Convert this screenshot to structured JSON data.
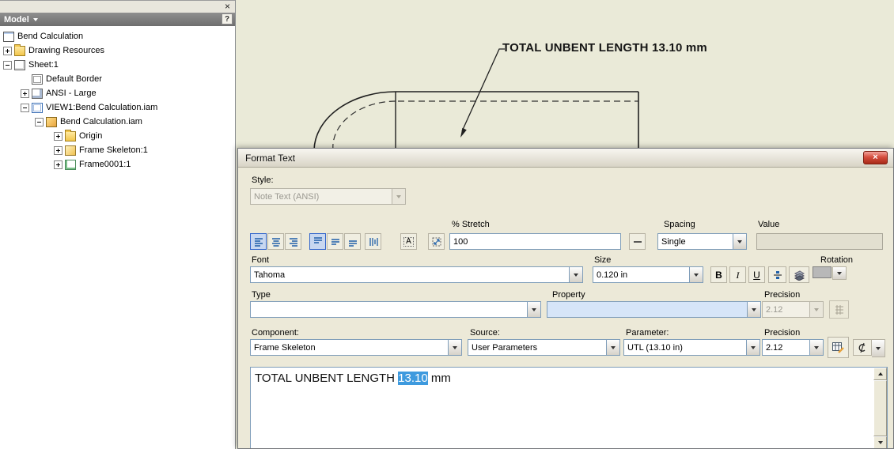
{
  "colors": {
    "selection_highlight": "#3E9ADE",
    "drawing_background": "#EAEAD8",
    "dialog_face": "#ECE9D8",
    "titlebar_close_red": "#C84135",
    "toolbar_selected": "#C8D7F0"
  },
  "panel": {
    "close_glyph": "×",
    "header": {
      "title": "Model",
      "help_glyph": "?"
    },
    "tree": [
      {
        "label": "Bend Calculation"
      },
      {
        "label": "Drawing Resources"
      },
      {
        "label": "Sheet:1"
      },
      {
        "label": "Default Border"
      },
      {
        "label": "ANSI - Large"
      },
      {
        "label": "VIEW1:Bend Calculation.iam"
      },
      {
        "label": "Bend Calculation.iam"
      },
      {
        "label": "Origin"
      },
      {
        "label": "Frame Skeleton:1"
      },
      {
        "label": "Frame0001:1"
      }
    ]
  },
  "drawing": {
    "annotation": "TOTAL UNBENT LENGTH 13.10 mm"
  },
  "dialog": {
    "title": "Format Text",
    "close_glyph": "×",
    "style": {
      "label": "Style:",
      "value": "Note Text (ANSI)"
    },
    "stretch": {
      "label": "% Stretch",
      "value": "100"
    },
    "spacing": {
      "label": "Spacing",
      "value": "Single"
    },
    "value_field": {
      "label": "Value",
      "value": ""
    },
    "font": {
      "label": "Font",
      "value": "Tahoma"
    },
    "size": {
      "label": "Size",
      "value": "0.120 in"
    },
    "format": {
      "bold": "B",
      "italic": "I",
      "underline": "U"
    },
    "rotation": {
      "label": "Rotation"
    },
    "type": {
      "label": "Type",
      "value": ""
    },
    "property": {
      "label": "Property",
      "value": ""
    },
    "precision_upper": {
      "label": "Precision",
      "value": "2.12"
    },
    "component": {
      "label": "Component:",
      "value": "Frame Skeleton"
    },
    "source": {
      "label": "Source:",
      "value": "User Parameters"
    },
    "parameter": {
      "label": "Parameter:",
      "value": "UTL (13.10 in)"
    },
    "precision_lower": {
      "label": "Precision",
      "value": "2.12"
    },
    "icons": {
      "textbox_glyph": "A"
    },
    "editor": {
      "text_before": "TOTAL UNBENT LENGTH ",
      "text_selected": "13.10",
      "text_after": " mm"
    }
  }
}
